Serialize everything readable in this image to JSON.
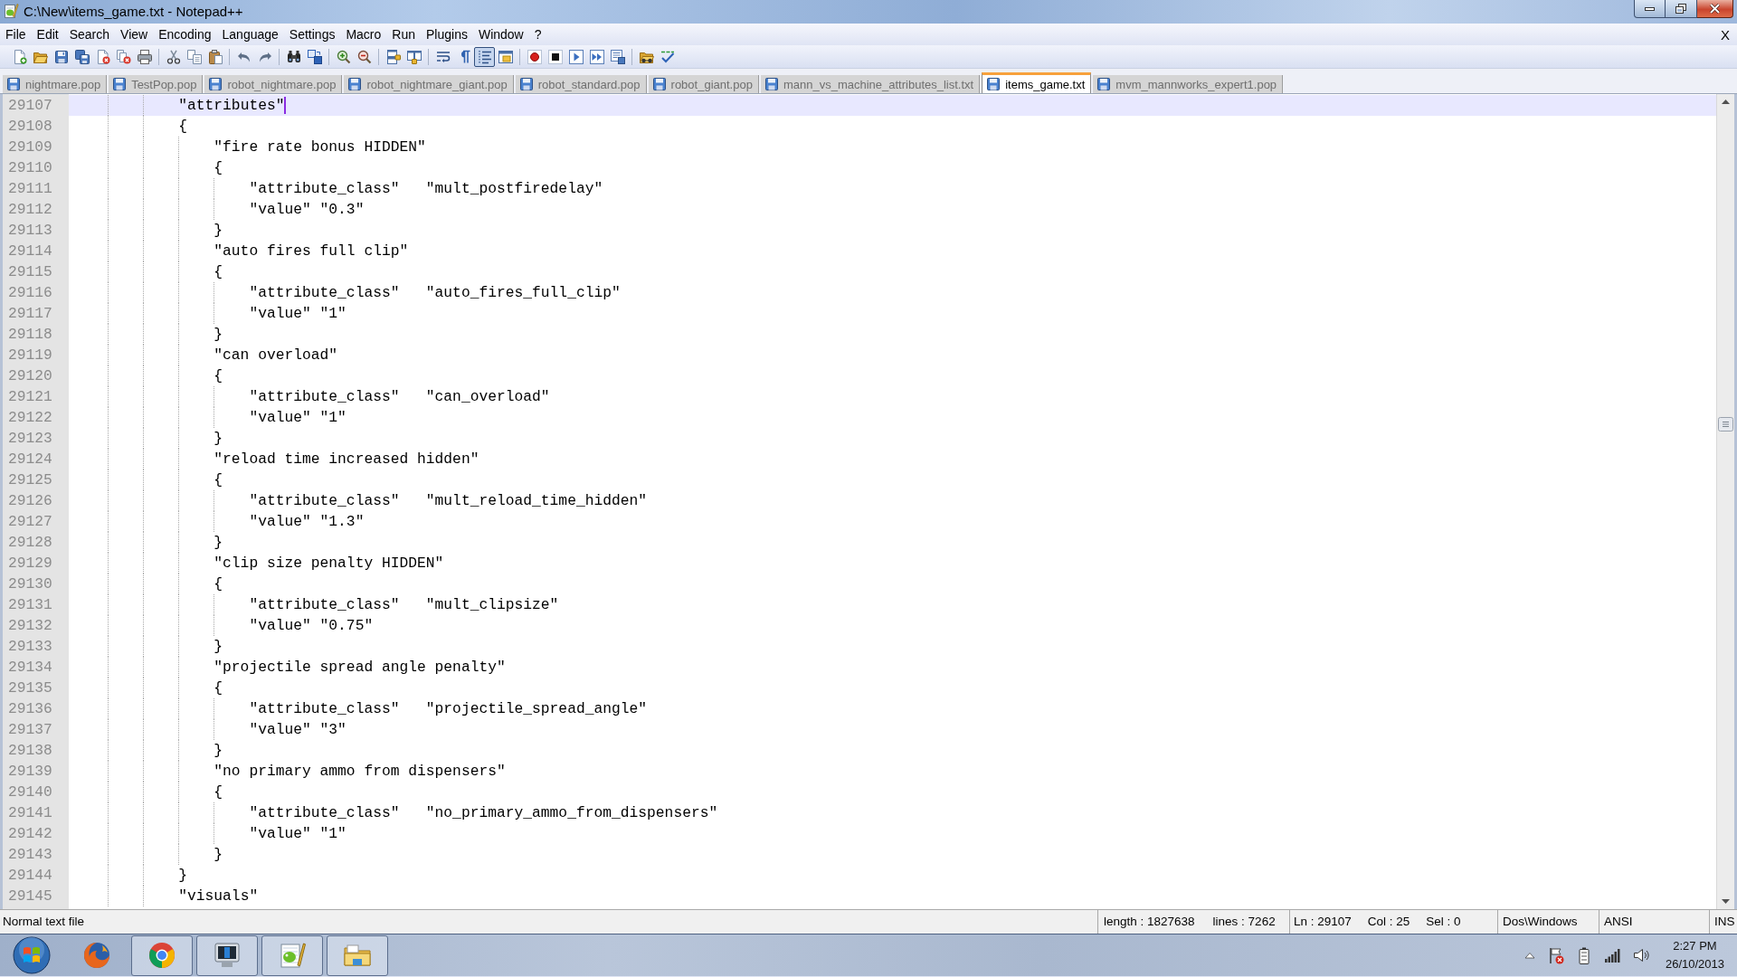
{
  "window": {
    "title": "C:\\New\\items_game.txt - Notepad++"
  },
  "menu_bar": {
    "items": [
      "File",
      "Edit",
      "Search",
      "View",
      "Encoding",
      "Language",
      "Settings",
      "Macro",
      "Run",
      "Plugins",
      "Window",
      "?"
    ],
    "close_document": "X"
  },
  "toolbar": {
    "groups": [
      [
        {
          "kind": "new",
          "on": false
        },
        {
          "kind": "open",
          "on": false
        },
        {
          "kind": "save",
          "on": false
        },
        {
          "kind": "saveall",
          "on": false
        },
        {
          "kind": "close",
          "on": false
        },
        {
          "kind": "closeall",
          "on": false
        },
        {
          "kind": "print",
          "on": false
        }
      ],
      [
        {
          "kind": "cut",
          "on": false
        },
        {
          "kind": "copy",
          "on": false
        },
        {
          "kind": "paste",
          "on": false
        }
      ],
      [
        {
          "kind": "undo",
          "on": false
        },
        {
          "kind": "redo",
          "on": false
        }
      ],
      [
        {
          "kind": "find",
          "on": false
        },
        {
          "kind": "replace",
          "on": false
        }
      ],
      [
        {
          "kind": "zoomin",
          "on": false
        },
        {
          "kind": "zoomout",
          "on": false
        }
      ],
      [
        {
          "kind": "syncv",
          "on": false
        },
        {
          "kind": "synch",
          "on": false
        }
      ],
      [
        {
          "kind": "wrap",
          "on": false
        },
        {
          "kind": "allchars",
          "on": false
        },
        {
          "kind": "indent",
          "on": true
        },
        {
          "kind": "udl",
          "on": false
        }
      ],
      [
        {
          "kind": "record",
          "on": false
        },
        {
          "kind": "stop",
          "on": false
        },
        {
          "kind": "play",
          "on": false
        },
        {
          "kind": "playmulti",
          "on": false
        },
        {
          "kind": "savemacro",
          "on": false
        }
      ],
      [
        {
          "kind": "browser",
          "on": false
        },
        {
          "kind": "spell",
          "on": false
        }
      ]
    ]
  },
  "tabs": [
    {
      "label": "nightmare.pop",
      "selected": false
    },
    {
      "label": "TestPop.pop",
      "selected": false
    },
    {
      "label": "robot_nightmare.pop",
      "selected": false
    },
    {
      "label": "robot_nightmare_giant.pop",
      "selected": false
    },
    {
      "label": "robot_standard.pop",
      "selected": false
    },
    {
      "label": "robot_giant.pop",
      "selected": false
    },
    {
      "label": "mann_vs_machine_attributes_list.txt",
      "selected": false
    },
    {
      "label": "items_game.txt",
      "selected": true
    },
    {
      "label": "mvm_mannworks_expert1.pop",
      "selected": false
    }
  ],
  "editor": {
    "lines": [
      {
        "number": "29107",
        "text": "\t\t\t\"attributes\"",
        "current": true
      },
      {
        "number": "29108",
        "text": "\t\t\t{",
        "current": false
      },
      {
        "number": "29109",
        "text": "\t\t\t\t\"fire rate bonus HIDDEN\"",
        "current": false
      },
      {
        "number": "29110",
        "text": "\t\t\t\t{",
        "current": false
      },
      {
        "number": "29111",
        "text": "\t\t\t\t\t\"attribute_class\"\t\"mult_postfiredelay\"",
        "current": false
      },
      {
        "number": "29112",
        "text": "\t\t\t\t\t\"value\" \"0.3\"",
        "current": false
      },
      {
        "number": "29113",
        "text": "\t\t\t\t}",
        "current": false
      },
      {
        "number": "29114",
        "text": "\t\t\t\t\"auto fires full clip\"",
        "current": false
      },
      {
        "number": "29115",
        "text": "\t\t\t\t{",
        "current": false
      },
      {
        "number": "29116",
        "text": "\t\t\t\t\t\"attribute_class\"\t\"auto_fires_full_clip\"",
        "current": false
      },
      {
        "number": "29117",
        "text": "\t\t\t\t\t\"value\" \"1\"",
        "current": false
      },
      {
        "number": "29118",
        "text": "\t\t\t\t}",
        "current": false
      },
      {
        "number": "29119",
        "text": "\t\t\t\t\"can overload\"",
        "current": false
      },
      {
        "number": "29120",
        "text": "\t\t\t\t{",
        "current": false
      },
      {
        "number": "29121",
        "text": "\t\t\t\t\t\"attribute_class\"\t\"can_overload\"",
        "current": false
      },
      {
        "number": "29122",
        "text": "\t\t\t\t\t\"value\" \"1\"",
        "current": false
      },
      {
        "number": "29123",
        "text": "\t\t\t\t}",
        "current": false
      },
      {
        "number": "29124",
        "text": "\t\t\t\t\"reload time increased hidden\"",
        "current": false
      },
      {
        "number": "29125",
        "text": "\t\t\t\t{",
        "current": false
      },
      {
        "number": "29126",
        "text": "\t\t\t\t\t\"attribute_class\"\t\"mult_reload_time_hidden\"",
        "current": false
      },
      {
        "number": "29127",
        "text": "\t\t\t\t\t\"value\" \"1.3\"",
        "current": false
      },
      {
        "number": "29128",
        "text": "\t\t\t\t}",
        "current": false
      },
      {
        "number": "29129",
        "text": "\t\t\t\t\"clip size penalty HIDDEN\"",
        "current": false
      },
      {
        "number": "29130",
        "text": "\t\t\t\t{",
        "current": false
      },
      {
        "number": "29131",
        "text": "\t\t\t\t\t\"attribute_class\"\t\"mult_clipsize\"",
        "current": false
      },
      {
        "number": "29132",
        "text": "\t\t\t\t\t\"value\" \"0.75\"",
        "current": false
      },
      {
        "number": "29133",
        "text": "\t\t\t\t}",
        "current": false
      },
      {
        "number": "29134",
        "text": "\t\t\t\t\"projectile spread angle penalty\"",
        "current": false
      },
      {
        "number": "29135",
        "text": "\t\t\t\t{",
        "current": false
      },
      {
        "number": "29136",
        "text": "\t\t\t\t\t\"attribute_class\"\t\"projectile_spread_angle\"",
        "current": false
      },
      {
        "number": "29137",
        "text": "\t\t\t\t\t\"value\" \"3\"",
        "current": false
      },
      {
        "number": "29138",
        "text": "\t\t\t\t}",
        "current": false
      },
      {
        "number": "29139",
        "text": "\t\t\t\t\"no primary ammo from dispensers\"",
        "current": false
      },
      {
        "number": "29140",
        "text": "\t\t\t\t{",
        "current": false
      },
      {
        "number": "29141",
        "text": "\t\t\t\t\t\"attribute_class\"\t\"no_primary_ammo_from_dispensers\"",
        "current": false
      },
      {
        "number": "29142",
        "text": "\t\t\t\t\t\"value\" \"1\"",
        "current": false
      },
      {
        "number": "29143",
        "text": "\t\t\t\t}",
        "current": false
      },
      {
        "number": "29144",
        "text": "\t\t\t}",
        "current": false
      },
      {
        "number": "29145",
        "text": "\t\t\t\"visuals\"",
        "current": false
      }
    ]
  },
  "status_bar": {
    "file_type": "Normal text file",
    "length": "length : 1827638",
    "lines": "lines : 7262",
    "line": "Ln : 29107",
    "column": "Col : 25",
    "selection": "Sel : 0",
    "line_ending": "Dos\\Windows",
    "encoding": "ANSI",
    "mode": "INS"
  },
  "taskbar": {
    "apps": [
      {
        "kind": "globe",
        "running": false
      },
      {
        "kind": "ring",
        "running": true
      },
      {
        "kind": "monitor",
        "running": true
      },
      {
        "kind": "notepad",
        "running": true
      },
      {
        "kind": "folder",
        "running": true
      }
    ],
    "clock": {
      "time": "2:27 PM",
      "date": "26/10/2013"
    }
  }
}
